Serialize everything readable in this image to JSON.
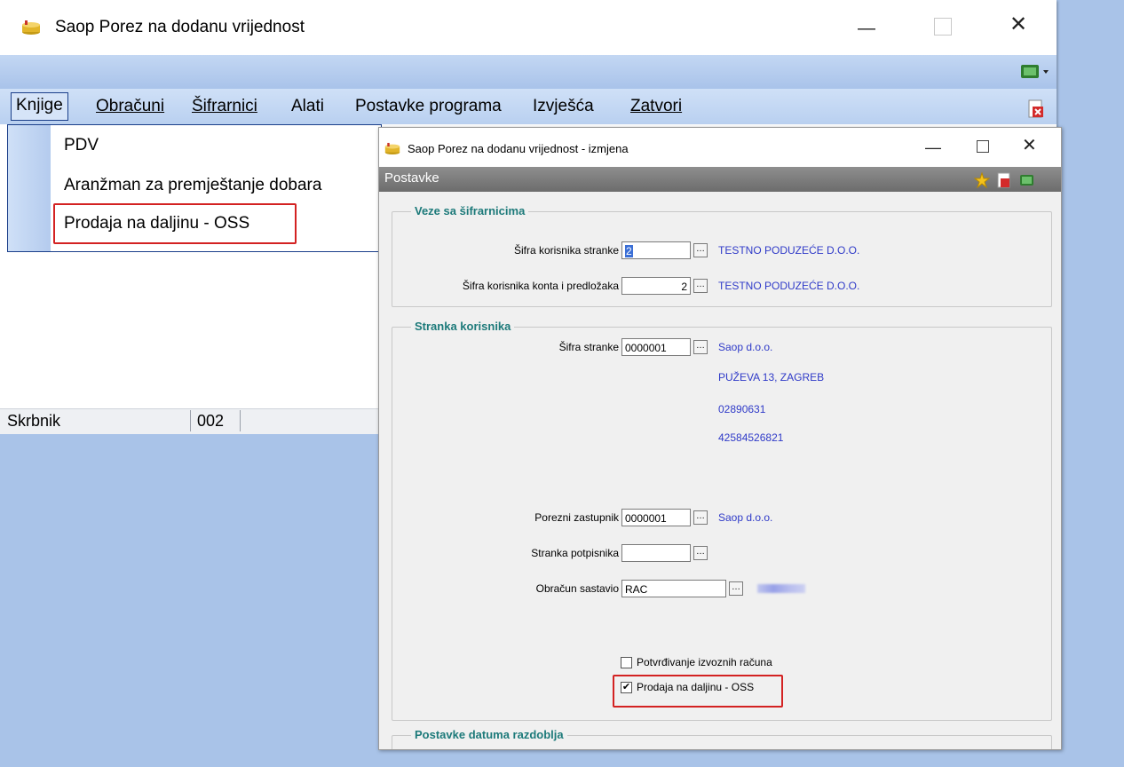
{
  "main_window": {
    "title": "Saop Porez na dodanu vrijednost",
    "menu": {
      "knjige": "Knjige",
      "obracuni": "Obračuni",
      "sifrarnici": "Šifrarnici",
      "alati": "Alati",
      "postavke": "Postavke programa",
      "izvjesca": "Izvješća",
      "zatvori": "Zatvori"
    },
    "dropdown": [
      "PDV",
      "Aranžman za premještanje dobara",
      "Prodaja na daljinu - OSS"
    ],
    "status": {
      "user": "Skrbnik",
      "code": "002"
    }
  },
  "dialog": {
    "title": "Saop Porez na dodanu vrijednost - izmjena",
    "panel_title": "Postavke",
    "veze": {
      "title": "Veze sa šifrarnicima",
      "sifra_korisnika_label": "Šifra korisnika stranke",
      "sifra_korisnika_value": "2",
      "sifra_korisnika_name": "TESTNO PODUZEĆE D.O.O.",
      "sifra_konta_label": "Šifra korisnika konta i predložaka",
      "sifra_konta_value": "2",
      "sifra_konta_name": "TESTNO PODUZEĆE D.O.O."
    },
    "stranka": {
      "title": "Stranka korisnika",
      "sifra_stranke_label": "Šifra stranke",
      "sifra_stranke_value": "0000001",
      "name": "Saop d.o.o.",
      "address": "PUŽEVA 13, ZAGREB",
      "id1": "02890631",
      "id2": "42584526821",
      "porezni_label": "Porezni zastupnik",
      "porezni_value": "0000001",
      "porezni_name": "Saop d.o.o.",
      "potpisnik_label": "Stranka potpisnika",
      "potpisnik_value": "",
      "obracun_label": "Obračun sastavio",
      "obracun_value": "RAC",
      "chk_izvoz_label": "Potvrđivanje izvoznih računa",
      "chk_izvoz_checked": false,
      "chk_oss_label": "Prodaja na daljinu - OSS",
      "chk_oss_checked": true
    },
    "datum": {
      "title": "Postavke datuma razdoblja"
    }
  },
  "colors": {
    "highlight_border": "#d32222",
    "link_blue": "#2f3ac8",
    "group_title": "#1d7a7a",
    "desktop": "#a9c3e8"
  }
}
